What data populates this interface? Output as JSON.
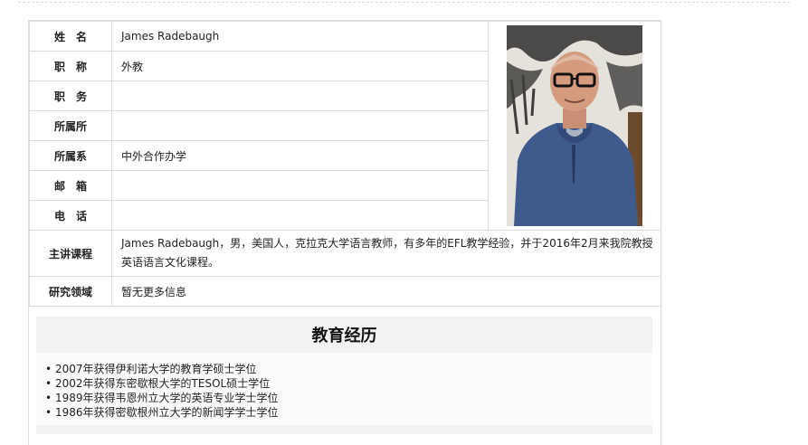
{
  "profile": {
    "rows": [
      {
        "label": "姓　名",
        "value": "James Radebaugh"
      },
      {
        "label": "职　称",
        "value": "外教"
      },
      {
        "label": "职　务",
        "value": ""
      },
      {
        "label": "所属所",
        "value": ""
      },
      {
        "label": "所属系",
        "value": "中外合作办学"
      },
      {
        "label": "邮　箱",
        "value": ""
      },
      {
        "label": "电　话",
        "value": ""
      }
    ],
    "course_label": "主讲课程",
    "course_value": "James Radebaugh，男，美国人，克拉克大学语言教师，有多年的EFL教学经验，并于2016年2月来我院教授英语语言文化课程。",
    "research_label": "研究领域",
    "research_value": "暂无更多信息"
  },
  "education": {
    "title": "教育经历",
    "items": [
      "2007年获得伊利诺大学的教育学硕士学位",
      "2002年获得东密歇根大学的TESOL硕士学位",
      "1989年获得韦恩州立大学的英语专业学士学位",
      "1986年获得密歇根州立大学的新闻学学士学位"
    ]
  },
  "colors": {
    "border": "#dcdcdc",
    "section_bg": "#f2f2f2"
  }
}
